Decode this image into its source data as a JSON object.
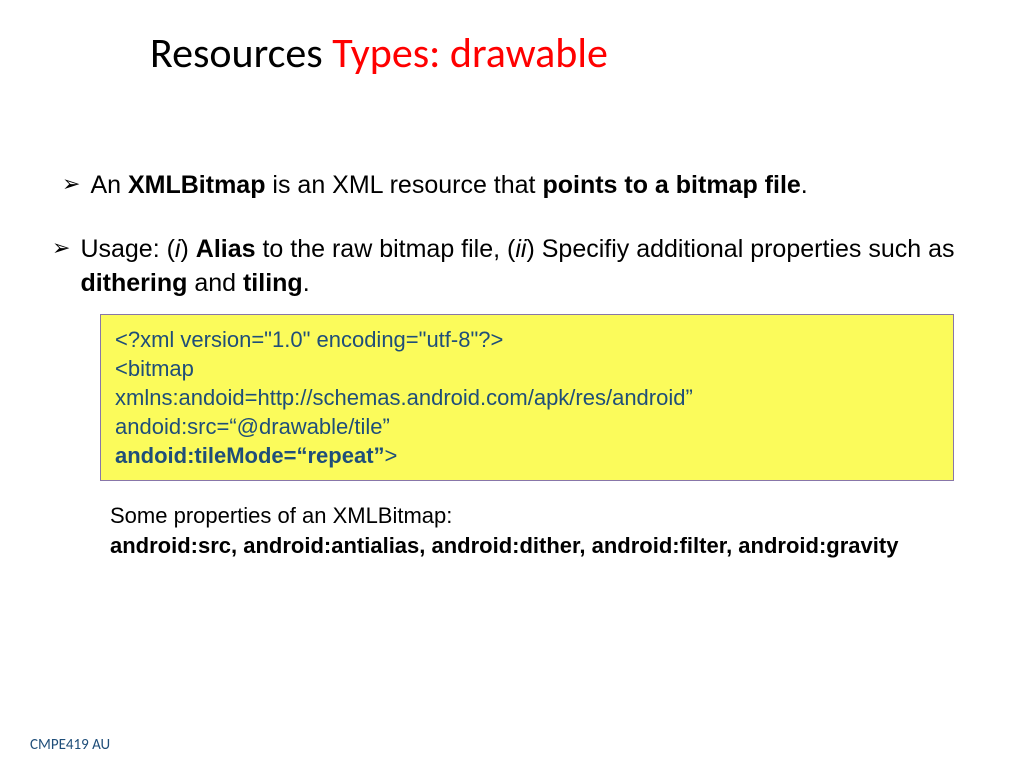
{
  "title": {
    "prefix": "Resources ",
    "suffix": "Types: drawable"
  },
  "bullet1": {
    "t1": "An ",
    "t2": "XMLBitmap",
    "t3": " is an XML resource that ",
    "t4": "points to a bitmap file",
    "t5": "."
  },
  "bullet2": {
    "t1": "Usage: (",
    "i1": "i",
    "t2": ") ",
    "b1": "Alias",
    "t3": " to the raw bitmap file, (",
    "i2": "ii",
    "t4": ") Specifiy additional properties such as ",
    "b2": "dithering",
    "t5": " and ",
    "b3": "tiling",
    "t6": "."
  },
  "code": {
    "l1": "<?xml version=\"1.0\" encoding=\"utf-8\"?>",
    "l2": "<bitmap",
    "l3": "xmlns:andoid=http://schemas.android.com/apk/res/android”",
    "l4": "andoid:src=“@drawable/tile”",
    "l5b": "andoid:tileMode=“repeat”",
    "l5end": ">"
  },
  "props": {
    "intro": "Some properties of an XMLBitmap:",
    "list": "android:src, android:antialias, android:dither, android:filter, android:gravity"
  },
  "footer": "CMPE419 AU"
}
